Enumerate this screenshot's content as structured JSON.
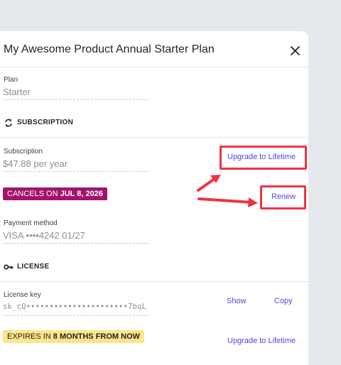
{
  "modal": {
    "title": "My Awesome Product Annual Starter Plan"
  },
  "plan": {
    "label": "Plan",
    "value": "Starter"
  },
  "subscription_section": {
    "title": "SUBSCRIPTION",
    "field_label": "Subscription",
    "field_value": "$47.88 per year",
    "upgrade_label": "Upgrade to Lifetime",
    "cancel_badge_prefix": "CANCELS ON ",
    "cancel_badge_date": "JUL 8, 2026",
    "renew_label": "Renew",
    "payment_label": "Payment method",
    "payment_value": "VISA ••••4242 01/27"
  },
  "license_section": {
    "title": "LICENSE",
    "key_label": "License key",
    "key_value": "sk_cQ••••••••••••••••••••••7bqL",
    "show_label": "Show",
    "copy_label": "Copy",
    "expires_prefix": "EXPIRES IN ",
    "expires_bold": "8 MONTHS FROM NOW",
    "upgrade_label": "Upgrade to Lifetime"
  },
  "colors": {
    "accent": "#4f46e5",
    "cancel_badge_bg": "#a3136c",
    "expires_badge_bg": "#fde58a",
    "annotation": "#ee3443"
  },
  "icons": {
    "close": "close-icon",
    "subscription": "refresh-icon",
    "license": "key-icon"
  }
}
